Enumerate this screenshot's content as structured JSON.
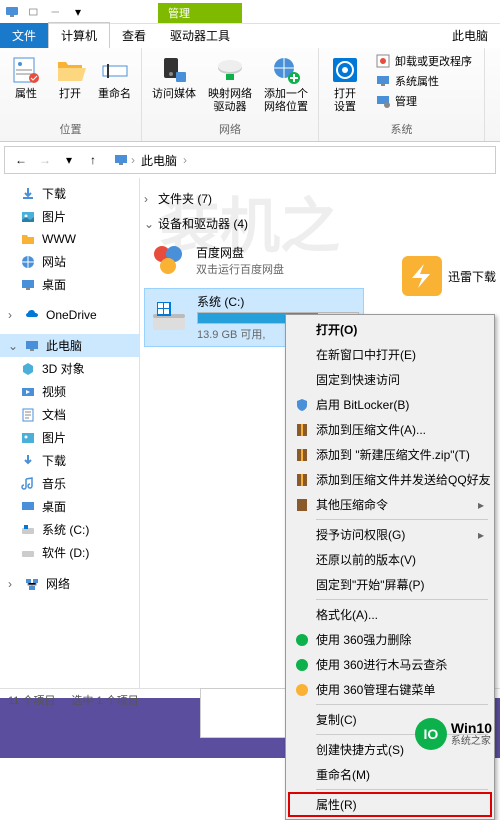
{
  "titlebar": {
    "title": "此电脑"
  },
  "ribbon_tabs": {
    "file": "文件",
    "computer": "计算机",
    "view": "查看",
    "manage": "管理",
    "drive_tools": "驱动器工具"
  },
  "ribbon": {
    "location": {
      "label": "位置",
      "properties": "属性",
      "open": "打开",
      "rename": "重命名"
    },
    "network": {
      "label": "网络",
      "access_media": "访问媒体",
      "map_drive": "映射网络\n驱动器",
      "add_location": "添加一个\n网络位置"
    },
    "system": {
      "label": "系统",
      "open_settings": "打开\n设置",
      "uninstall": "卸载或更改程序",
      "sys_props": "系统属性",
      "manage": "管理"
    }
  },
  "breadcrumb": {
    "this_pc": "此电脑"
  },
  "sidebar": {
    "downloads": "下载",
    "pictures": "图片",
    "www": "WWW",
    "websites": "网站",
    "desktop": "桌面",
    "onedrive": "OneDrive",
    "this_pc": "此电脑",
    "objects_3d": "3D 对象",
    "videos": "视频",
    "documents": "文档",
    "music": "音乐",
    "desktop2": "桌面",
    "system_c": "系统 (C:)",
    "software_d": "软件 (D:)",
    "network": "网络"
  },
  "main": {
    "folders_header": "文件夹 (7)",
    "devices_header": "设备和驱动器 (4)",
    "baidu": {
      "name": "百度网盘",
      "sub": "双击运行百度网盘"
    },
    "system_c": {
      "name": "系统 (C:)",
      "sub": "13.9 GB 可用,"
    },
    "thunder": "迅雷下载"
  },
  "context_menu": {
    "open": "打开(O)",
    "open_new_window": "在新窗口中打开(E)",
    "pin_quick": "固定到快速访问",
    "bitlocker": "启用 BitLocker(B)",
    "add_archive": "添加到压缩文件(A)...",
    "add_zip": "添加到 \"新建压缩文件.zip\"(T)",
    "add_send_qq": "添加到压缩文件并发送给QQ好友",
    "other_compress": "其他压缩命令",
    "grant_access": "授予访问权限(G)",
    "restore_version": "还原以前的版本(V)",
    "pin_start": "固定到\"开始\"屏幕(P)",
    "format": "格式化(A)...",
    "force_delete_360": "使用 360强力删除",
    "trojan_scan_360": "使用 360进行木马云查杀",
    "right_menu_360": "使用 360管理右键菜单",
    "copy": "复制(C)",
    "create_shortcut": "创建快捷方式(S)",
    "rename": "重命名(M)",
    "properties": "属性(R)"
  },
  "statusbar": {
    "items": "11 个项目",
    "selected": "选中 1 个项目"
  },
  "win10": {
    "badge": "IO",
    "main": "Win10",
    "sub": "系统之家"
  },
  "watermark": "装机之"
}
